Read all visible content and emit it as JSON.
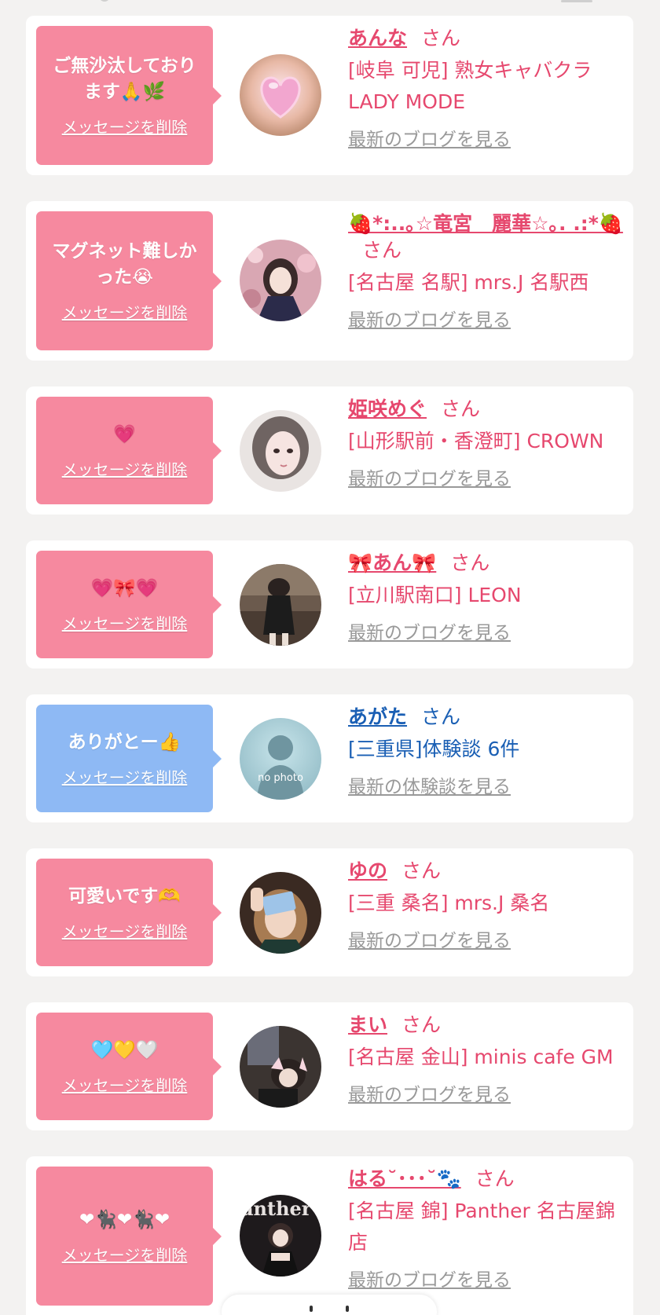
{
  "delete_label": "メッセージを削除",
  "san": "さん",
  "colors": {
    "pink_bubble": "#f6899f",
    "blue_bubble": "#8eb9f4",
    "pink_text": "#e6486e",
    "blue_text": "#1a5fb4",
    "link_gray": "#999999"
  },
  "cards": [
    {
      "message": "ご無沙汰しております🙏🌿",
      "name": "あんな",
      "shop": "[岐阜 可児] 熟女キャバクラLADY MODE",
      "link": "最新のブログを見る",
      "avatar_icon": "heart-photo-icon"
    },
    {
      "message": "マグネット難しかった😭",
      "name": "🍓*:..｡☆竜宮　麗華☆｡. .:*🍓",
      "shop": "[名古屋 名駅] mrs.J 名駅西",
      "link": "最新のブログを見る",
      "avatar_icon": "profile-photo-icon"
    },
    {
      "message": "💗",
      "name": "姫咲めぐ",
      "shop": "[山形駅前・香澄町] CROWN",
      "link": "最新のブログを見る",
      "avatar_icon": "profile-photo-icon"
    },
    {
      "message": "💗🎀💗",
      "name": "🎀あん🎀",
      "shop": "[立川駅南口] LEON",
      "link": "最新のブログを見る",
      "avatar_icon": "profile-photo-icon"
    },
    {
      "message": "ありがとー👍",
      "name": "あがた",
      "shop": "[三重県]体験談 6件",
      "link": "最新の体験談を見る",
      "avatar_icon": "no-photo-icon",
      "avatar_caption": "no photo"
    },
    {
      "message": "可愛いです🫶",
      "name": "ゆの",
      "shop": "[三重 桑名] mrs.J 桑名",
      "link": "最新のブログを見る",
      "avatar_icon": "profile-photo-icon"
    },
    {
      "message": "🩵💛🤍",
      "name": "まい",
      "shop": "[名古屋 金山] minis cafe GM",
      "link": "最新のブログを見る",
      "avatar_icon": "profile-photo-icon"
    },
    {
      "message": "❤🐈‍⬛❤🐈‍⬛❤",
      "name": "はる˘･･･˘🐾",
      "shop": "[名古屋 錦] Panther 名古屋錦店",
      "link": "最新のブログを見る",
      "avatar_icon": "profile-photo-icon"
    }
  ]
}
